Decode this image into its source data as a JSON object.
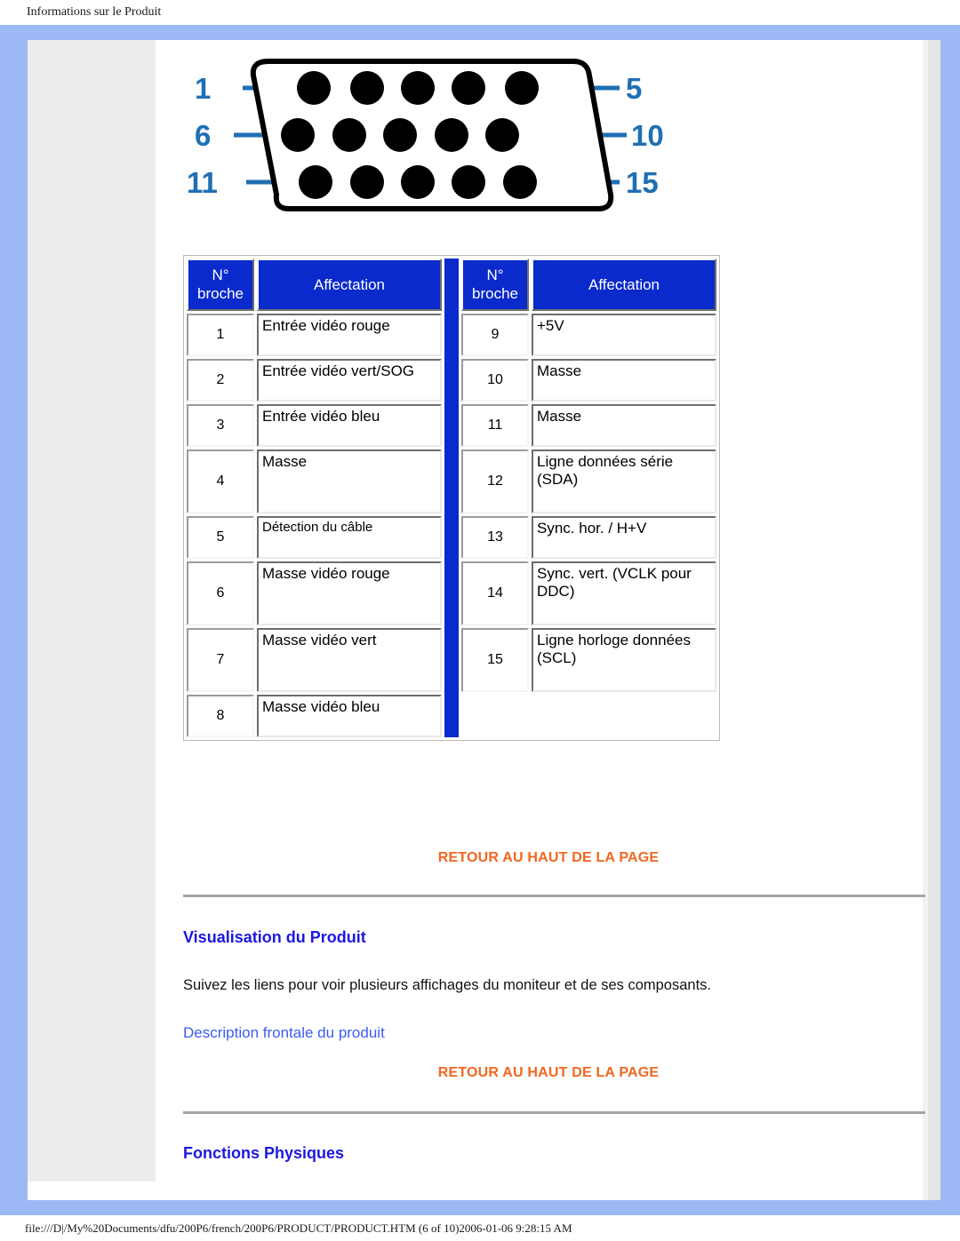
{
  "print_header": {
    "title": "Informations sur le Produit"
  },
  "print_footer": {
    "path": "file:///D|/My%20Documents/dfu/200P6/french/200P6/PRODUCT/PRODUCT.HTM (6 of 10)2006-01-06 9:28:15 AM"
  },
  "connector": {
    "name": "d-sub-15-pin-connector",
    "labels": {
      "top_left": "1",
      "top_right": "5",
      "mid_left": "6",
      "mid_right": "10",
      "bottom_left": "11",
      "bottom_right": "15"
    },
    "label_color": "#1f6fb4",
    "pin_color": "#000000",
    "shell_color": "#000000"
  },
  "pin_table": {
    "headers": {
      "number": "N°\nbroche",
      "number_line1": "N°",
      "number_line2": "broche",
      "assignment": "Affectation"
    },
    "header_bg": "#0a2acc",
    "header_fg": "#ffffff",
    "left_rows": [
      {
        "pin": "1",
        "assignment": "Entrée vidéo rouge"
      },
      {
        "pin": "2",
        "assignment": "Entrée vidéo vert/SOG"
      },
      {
        "pin": "3",
        "assignment": "Entrée vidéo bleu"
      },
      {
        "pin": "4",
        "assignment": "Masse"
      },
      {
        "pin": "5",
        "assignment": "Détection du câble"
      },
      {
        "pin": "6",
        "assignment": "Masse vidéo rouge"
      },
      {
        "pin": "7",
        "assignment": "Masse vidéo vert"
      },
      {
        "pin": "8",
        "assignment": "Masse vidéo bleu"
      }
    ],
    "right_rows": [
      {
        "pin": "9",
        "assignment": "+5V"
      },
      {
        "pin": "10",
        "assignment": "Masse"
      },
      {
        "pin": "11",
        "assignment": "Masse"
      },
      {
        "pin": "12",
        "assignment": "Ligne données série (SDA)"
      },
      {
        "pin": "13",
        "assignment": "Sync. hor. / H+V"
      },
      {
        "pin": "14",
        "assignment": "Sync. vert. (VCLK pour DDC)"
      },
      {
        "pin": "15",
        "assignment": "Ligne horloge données (SCL)"
      }
    ]
  },
  "sections": {
    "back_to_top_1": "RETOUR AU HAUT DE LA PAGE",
    "back_to_top_2": "RETOUR AU HAUT DE LA PAGE",
    "visualisation_title": "Visualisation du Produit",
    "visualisation_text": "Suivez les liens pour voir plusieurs affichages du moniteur et de ses composants.",
    "description_link": "Description frontale du produit",
    "fonctions_title": "Fonctions Physiques"
  },
  "colors": {
    "frame_blue": "#9db9f5",
    "table_blue": "#0a2acc",
    "link_orange": "#f2661f",
    "heading_blue": "#1c18e0",
    "link_blue": "#3d5bf5",
    "nav_grey": "#ececec"
  }
}
